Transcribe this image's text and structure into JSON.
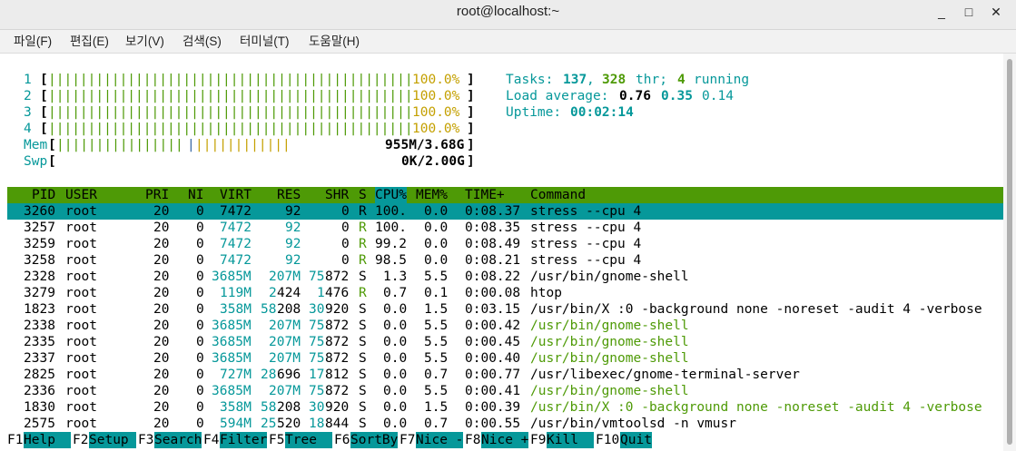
{
  "window": {
    "title": "root@localhost:~",
    "controls": [
      "_",
      "□",
      "✕"
    ]
  },
  "menu": [
    {
      "label": "파일(F)"
    },
    {
      "label": "편집(E)"
    },
    {
      "label": "보기(V)"
    },
    {
      "label": "검색(S)"
    },
    {
      "label": "터미널(T)"
    },
    {
      "label": "도움말(H)"
    }
  ],
  "meters": {
    "cpus": [
      {
        "id": "1",
        "pct": "100.0%",
        "value": 1.0
      },
      {
        "id": "2",
        "pct": "100.0%",
        "value": 1.0
      },
      {
        "id": "3",
        "pct": "100.0%",
        "value": 1.0
      },
      {
        "id": "4",
        "pct": "100.0%",
        "value": 1.0
      }
    ],
    "mem": {
      "label": "Mem",
      "text": "955M/3.68G",
      "value": 0.26
    },
    "swp": {
      "label": "Swp",
      "text": "0K/2.00G",
      "value": 0.0
    }
  },
  "summary": {
    "tasks_label": "Tasks:",
    "tasks": "137",
    "threads": "328",
    "thr_label": "thr;",
    "running": "4",
    "running_label": "running",
    "load_label": "Load average:",
    "load1": "0.76",
    "load5": "0.35",
    "load15": "0.14",
    "uptime_label": "Uptime:",
    "uptime": "00:02:14"
  },
  "table": {
    "headers": [
      "PID",
      "USER",
      "PRI",
      "NI",
      "VIRT",
      "RES",
      "SHR",
      "S",
      "CPU%",
      "MEM%",
      "TIME+",
      "Command"
    ],
    "rows": [
      {
        "pid": "3260",
        "user": "root",
        "pri": "20",
        "ni": "0",
        "virt": "7472",
        "res": "92",
        "shr": "0",
        "s": "R",
        "cpu": "100.",
        "mem": "0.0",
        "time": "0:08.37",
        "cmd": "stress --cpu 4",
        "thread": false
      },
      {
        "pid": "3257",
        "user": "root",
        "pri": "20",
        "ni": "0",
        "virt": "7472",
        "res": "92",
        "shr": "0",
        "s": "R",
        "cpu": "100.",
        "mem": "0.0",
        "time": "0:08.35",
        "cmd": "stress --cpu 4",
        "thread": false
      },
      {
        "pid": "3259",
        "user": "root",
        "pri": "20",
        "ni": "0",
        "virt": "7472",
        "res": "92",
        "shr": "0",
        "s": "R",
        "cpu": "99.2",
        "mem": "0.0",
        "time": "0:08.49",
        "cmd": "stress --cpu 4",
        "thread": false
      },
      {
        "pid": "3258",
        "user": "root",
        "pri": "20",
        "ni": "0",
        "virt": "7472",
        "res": "92",
        "shr": "0",
        "s": "R",
        "cpu": "98.5",
        "mem": "0.0",
        "time": "0:08.21",
        "cmd": "stress --cpu 4",
        "thread": false
      },
      {
        "pid": "2328",
        "user": "root",
        "pri": "20",
        "ni": "0",
        "virt": "3685M",
        "res": "207M",
        "shr": "75872",
        "s": "S",
        "cpu": "1.3",
        "mem": "5.5",
        "time": "0:08.22",
        "cmd": "/usr/bin/gnome-shell",
        "thread": false
      },
      {
        "pid": "3279",
        "user": "root",
        "pri": "20",
        "ni": "0",
        "virt": "119M",
        "res": "2424",
        "shr": "1476",
        "s": "R",
        "cpu": "0.7",
        "mem": "0.1",
        "time": "0:00.08",
        "cmd": "htop",
        "thread": false
      },
      {
        "pid": "1823",
        "user": "root",
        "pri": "20",
        "ni": "0",
        "virt": "358M",
        "res": "58208",
        "shr": "30920",
        "s": "S",
        "cpu": "0.0",
        "mem": "1.5",
        "time": "0:03.15",
        "cmd": "/usr/bin/X :0 -background none -noreset -audit 4 -verbose",
        "thread": false
      },
      {
        "pid": "2338",
        "user": "root",
        "pri": "20",
        "ni": "0",
        "virt": "3685M",
        "res": "207M",
        "shr": "75872",
        "s": "S",
        "cpu": "0.0",
        "mem": "5.5",
        "time": "0:00.42",
        "cmd": "/usr/bin/gnome-shell",
        "thread": true
      },
      {
        "pid": "2335",
        "user": "root",
        "pri": "20",
        "ni": "0",
        "virt": "3685M",
        "res": "207M",
        "shr": "75872",
        "s": "S",
        "cpu": "0.0",
        "mem": "5.5",
        "time": "0:00.45",
        "cmd": "/usr/bin/gnome-shell",
        "thread": true
      },
      {
        "pid": "2337",
        "user": "root",
        "pri": "20",
        "ni": "0",
        "virt": "3685M",
        "res": "207M",
        "shr": "75872",
        "s": "S",
        "cpu": "0.0",
        "mem": "5.5",
        "time": "0:00.40",
        "cmd": "/usr/bin/gnome-shell",
        "thread": true
      },
      {
        "pid": "2825",
        "user": "root",
        "pri": "20",
        "ni": "0",
        "virt": "727M",
        "res": "28696",
        "shr": "17812",
        "s": "S",
        "cpu": "0.0",
        "mem": "0.7",
        "time": "0:00.77",
        "cmd": "/usr/libexec/gnome-terminal-server",
        "thread": false
      },
      {
        "pid": "2336",
        "user": "root",
        "pri": "20",
        "ni": "0",
        "virt": "3685M",
        "res": "207M",
        "shr": "75872",
        "s": "S",
        "cpu": "0.0",
        "mem": "5.5",
        "time": "0:00.41",
        "cmd": "/usr/bin/gnome-shell",
        "thread": true
      },
      {
        "pid": "1830",
        "user": "root",
        "pri": "20",
        "ni": "0",
        "virt": "358M",
        "res": "58208",
        "shr": "30920",
        "s": "S",
        "cpu": "0.0",
        "mem": "1.5",
        "time": "0:00.39",
        "cmd": "/usr/bin/X :0 -background none -noreset -audit 4 -verbose",
        "thread": true
      },
      {
        "pid": "2575",
        "user": "root",
        "pri": "20",
        "ni": "0",
        "virt": "594M",
        "res": "25520",
        "shr": "18844",
        "s": "S",
        "cpu": "0.0",
        "mem": "0.7",
        "time": "0:00.55",
        "cmd": "/usr/bin/vmtoolsd -n vmusr",
        "thread": false
      }
    ]
  },
  "fkeys": [
    {
      "key": "F1",
      "label": "Help  "
    },
    {
      "key": "F2",
      "label": "Setup "
    },
    {
      "key": "F3",
      "label": "Search"
    },
    {
      "key": "F4",
      "label": "Filter"
    },
    {
      "key": "F5",
      "label": "Tree  "
    },
    {
      "key": "F6",
      "label": "SortBy"
    },
    {
      "key": "F7",
      "label": "Nice -"
    },
    {
      "key": "F8",
      "label": "Nice +"
    },
    {
      "key": "F9",
      "label": "Kill  "
    },
    {
      "key": "F10",
      "label": "Quit"
    }
  ],
  "colors": {
    "header_bg": "#4e9a06",
    "selection_bg": "#06989a",
    "cyan": "#06989a",
    "green": "#4e9a06",
    "yellow": "#c4a000",
    "blue": "#3465a4"
  }
}
